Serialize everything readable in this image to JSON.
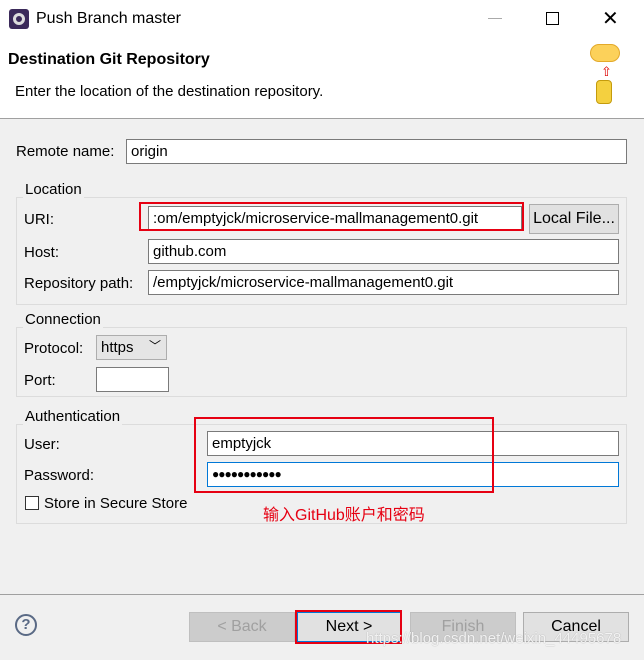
{
  "window": {
    "title": "Push Branch master"
  },
  "header": {
    "title": "Destination Git Repository",
    "description": "Enter the location of the destination repository."
  },
  "remote": {
    "label": "Remote name:",
    "value": "origin"
  },
  "location": {
    "group": "Location",
    "uri_label": "URI:",
    "uri_value": ":om/emptyjck/microservice-mallmanagement0.git",
    "local_file": "Local File...",
    "host_label": "Host:",
    "host_value": "github.com",
    "path_label": "Repository path:",
    "path_value": "/emptyjck/microservice-mallmanagement0.git"
  },
  "connection": {
    "group": "Connection",
    "protocol_label": "Protocol:",
    "protocol_value": "https",
    "port_label": "Port:",
    "port_value": ""
  },
  "auth": {
    "group": "Authentication",
    "user_label": "User:",
    "user_value": "emptyjck",
    "password_label": "Password:",
    "password_value": "●●●●●●●●●●●",
    "store_label": "Store in Secure Store"
  },
  "annotation": "输入GitHub账户和密码",
  "buttons": {
    "back": "< Back",
    "next": "Next >",
    "finish": "Finish",
    "cancel": "Cancel"
  },
  "watermark": "https://blog.csdn.net/weixin_44495678",
  "colors": {
    "annotation": "#e60012",
    "focus": "#0078d7"
  }
}
